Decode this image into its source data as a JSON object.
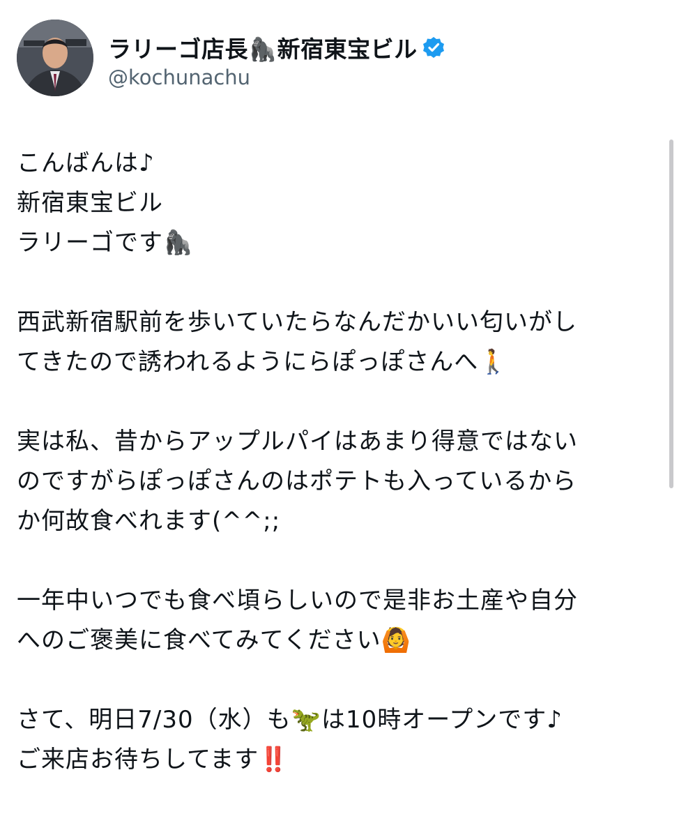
{
  "user": {
    "display_name": "ラリーゴ店長🦍新宿東宝ビル",
    "handle": "@kochunachu",
    "verified": true,
    "verified_color": "#1d9bf0"
  },
  "tweet": {
    "lines": [
      "こんばんは♪",
      "新宿東宝ビル",
      "ラリーゴです🦍",
      "",
      "西武新宿駅前を歩いていたらなんだかいい匂いがし",
      "てきたので誘われるようにらぽっぽさんへ🚶",
      "",
      "実は私、昔からアップルパイはあまり得意ではない",
      "のですがらぽっぽさんのはポテトも入っているから",
      "か何故食べれます(^^;;",
      "",
      "一年中いつでも食べ頃らしいので是非お土産や自分",
      "へのご褒美に食べてみてください🙆",
      "",
      "さて、明日7/30（水）も🦖は10時オープンです♪",
      "ご来店お待ちしてます‼️"
    ]
  },
  "colors": {
    "text": "#0f1419",
    "secondary": "#536471",
    "background": "#ffffff"
  }
}
